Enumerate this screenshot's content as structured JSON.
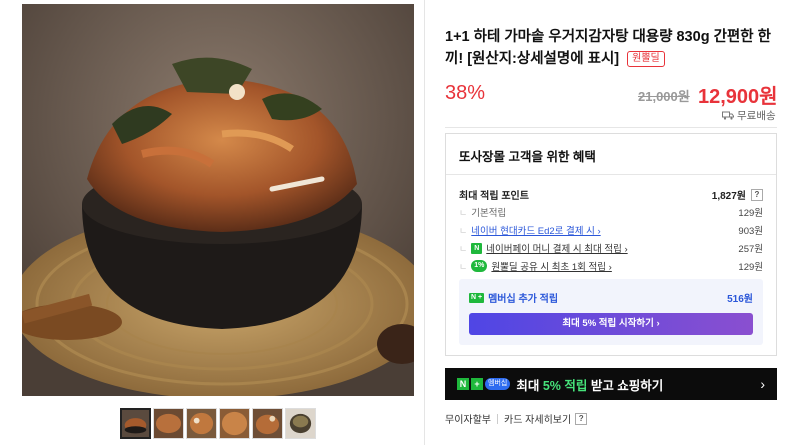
{
  "product": {
    "title": "1+1 하테 가마솥 우거지감자탕 대용량 830g 간편한 한끼! [원산지:상세설명에 표시]",
    "origin_badge": "원뿔딜",
    "discount": "38%",
    "original_price": "21,000원",
    "sale_price": "12,900원",
    "shipping": "무료배송"
  },
  "benefits": {
    "title": "또사장몰 고객을 위한 혜택",
    "max_points_label": "최대 적립 포인트",
    "max_points_value": "1,827원",
    "help": "?",
    "rows": [
      {
        "label": "기본적립",
        "value": "129원"
      },
      {
        "label": "네이버 현대카드 Ed2로 결제 시 ›",
        "value": "903원"
      },
      {
        "label": "네이버페이 머니 결제 시 최대 적립 ›",
        "value": "257원",
        "icon": "N"
      },
      {
        "label": "원뿔딜 공유 시 최초 1회 적립 ›",
        "value": "129원",
        "icon": "1%"
      }
    ],
    "membership_label": "멤버십 추가 적립",
    "membership_value": "516원",
    "membership_button": "최대 5% 적립 시작하기 ›"
  },
  "promo": {
    "badge_n": "N",
    "badge_plus": "+",
    "badge_member": "멤버십",
    "text_prefix": "최대 ",
    "text_highlight": "5% 적립",
    "text_suffix": " 받고 쇼핑하기",
    "arrow": "›"
  },
  "links": {
    "installment": "무이자할부",
    "card_details": "카드 자세히보기",
    "help": "?"
  },
  "colors": {
    "accent_red": "#e8333a",
    "link_blue": "#2b57d9",
    "naver_green": "#1fb83c",
    "banner_black": "#0c0c0c"
  }
}
